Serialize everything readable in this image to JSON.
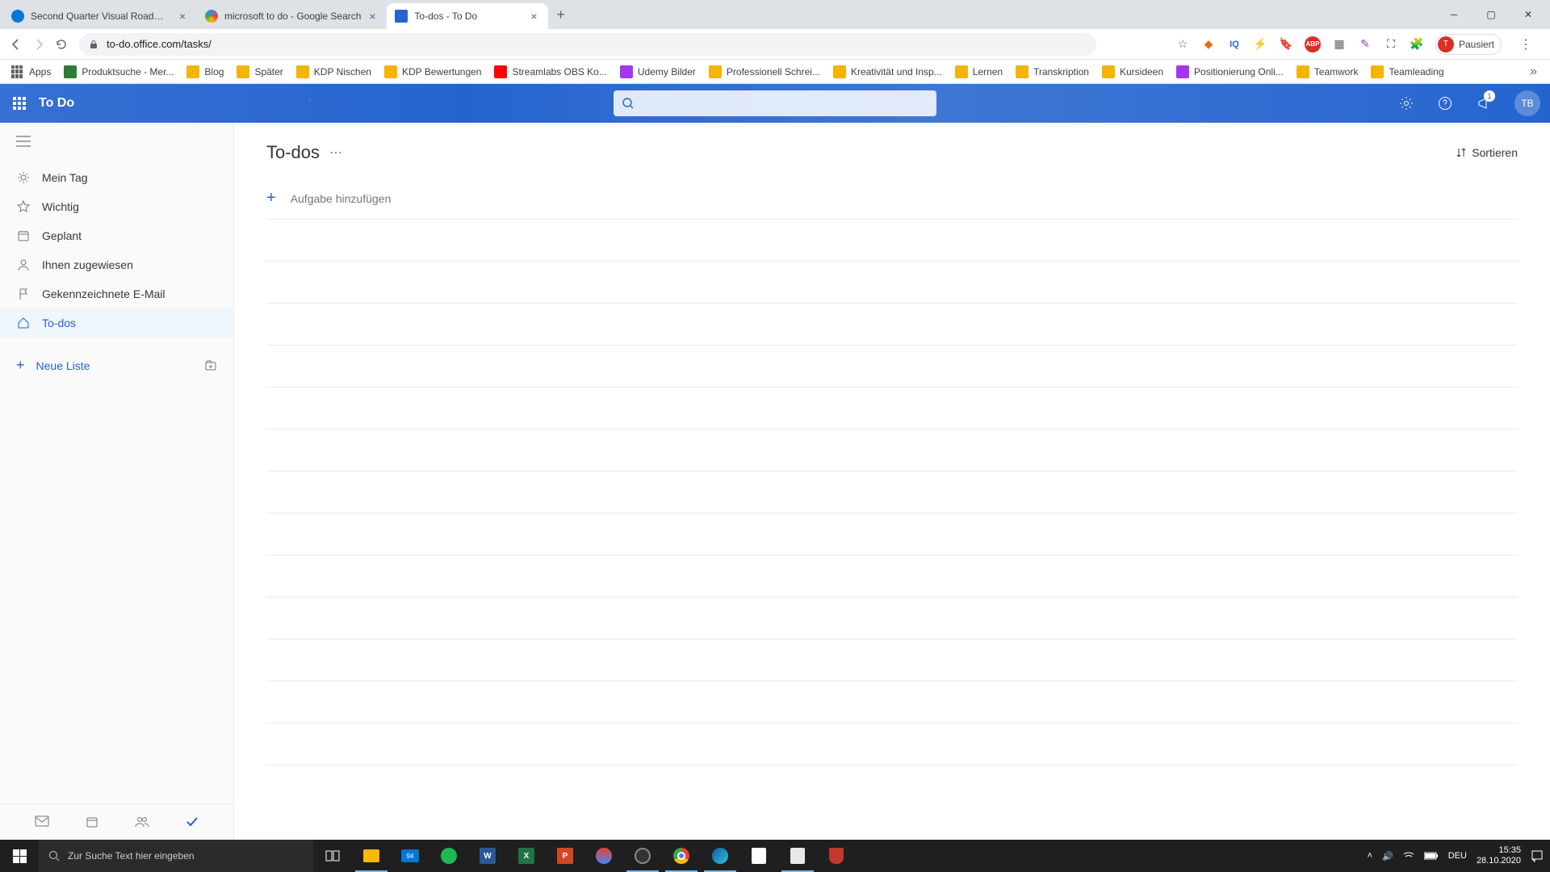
{
  "browser": {
    "tabs": [
      {
        "title": "Second Quarter Visual Roadmap",
        "favicon": "#0078d4"
      },
      {
        "title": "microsoft to do - Google Search",
        "favicon": "#4285f4"
      },
      {
        "title": "To-dos - To Do",
        "favicon": "#2564cf"
      }
    ],
    "url": "to-do.office.com/tasks/",
    "profile_label": "Pausiert",
    "profile_initial": "T",
    "bookmarks": [
      {
        "label": "Apps",
        "color": "#5f6368",
        "type": "apps"
      },
      {
        "label": "Produktsuche - Mer...",
        "color": "#2e7d32"
      },
      {
        "label": "Blog",
        "color": "#f4b400"
      },
      {
        "label": "Später",
        "color": "#f4b400"
      },
      {
        "label": "KDP Nischen",
        "color": "#f4b400"
      },
      {
        "label": "KDP Bewertungen",
        "color": "#f4b400"
      },
      {
        "label": "Streamlabs OBS Ko...",
        "color": "#ff0000"
      },
      {
        "label": "Udemy Bilder",
        "color": "#a435f0"
      },
      {
        "label": "Professionell Schrei...",
        "color": "#f4b400"
      },
      {
        "label": "Kreativität und Insp...",
        "color": "#f4b400"
      },
      {
        "label": "Lernen",
        "color": "#f4b400"
      },
      {
        "label": "Transkription",
        "color": "#f4b400"
      },
      {
        "label": "Kursideen",
        "color": "#f4b400"
      },
      {
        "label": "Positionierung Onli...",
        "color": "#a435f0"
      },
      {
        "label": "Teamwork",
        "color": "#f4b400"
      },
      {
        "label": "Teamleading",
        "color": "#f4b400"
      }
    ]
  },
  "app": {
    "title": "To Do",
    "notification_count": "1",
    "user_initials": "TB"
  },
  "sidebar": {
    "items": [
      {
        "label": "Mein Tag"
      },
      {
        "label": "Wichtig"
      },
      {
        "label": "Geplant"
      },
      {
        "label": "Ihnen zugewiesen"
      },
      {
        "label": "Gekennzeichnete E-Mail"
      },
      {
        "label": "To-dos"
      }
    ],
    "new_list": "Neue Liste"
  },
  "main": {
    "title": "To-dos",
    "sort_label": "Sortieren",
    "add_task_label": "Aufgabe hinzufügen"
  },
  "taskbar": {
    "search_placeholder": "Zur Suche Text hier eingeben",
    "lang": "DEU",
    "time": "15:35",
    "date": "28.10.2020"
  }
}
